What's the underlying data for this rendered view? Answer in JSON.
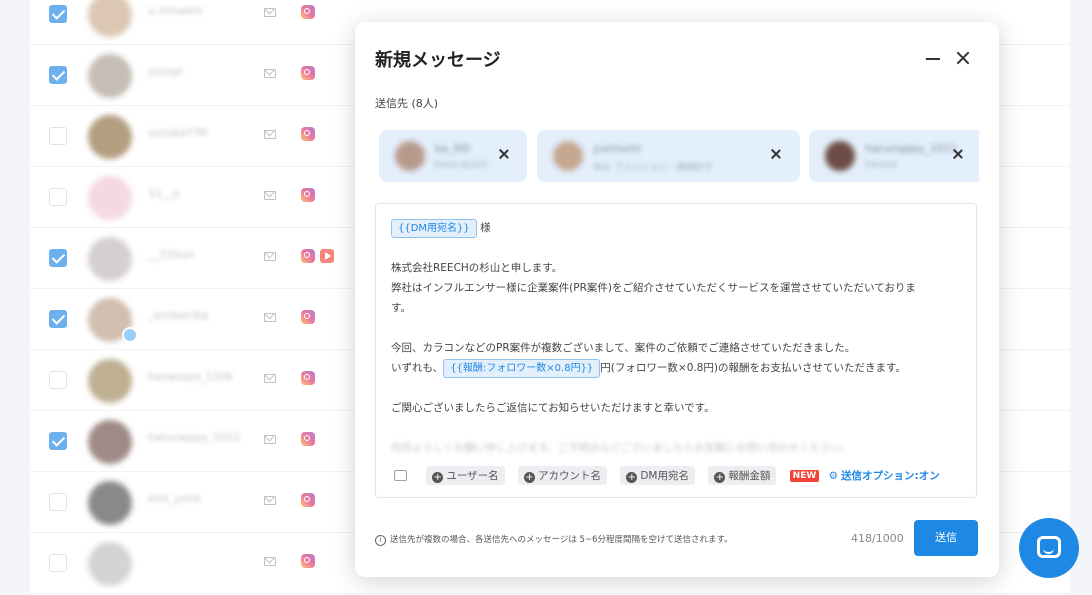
{
  "table": {
    "rows": [
      {
        "checked": true,
        "username": "u.misaato",
        "avatar_color": "#c9a98a",
        "youtube": false,
        "badge": false
      },
      {
        "checked": true,
        "username": "yumpi",
        "avatar_color": "#a89a8c",
        "youtube": false,
        "badge": false
      },
      {
        "checked": false,
        "username": "suzuka738",
        "avatar_color": "#8c6a3c",
        "youtube": false,
        "badge": false
      },
      {
        "checked": false,
        "username": "11__o",
        "avatar_color": "#f0c4d2",
        "youtube": false,
        "badge": false
      },
      {
        "checked": true,
        "username": "__31bun",
        "avatar_color": "#c0b6b8",
        "youtube": true,
        "badge": false
      },
      {
        "checked": true,
        "username": "_emiberika",
        "avatar_color": "#b89c84",
        "youtube": false,
        "badge": true
      },
      {
        "checked": false,
        "username": "kanasaya_110k",
        "avatar_color": "#9c8656",
        "youtube": false,
        "badge": false
      },
      {
        "checked": true,
        "username": "harunappy_1011",
        "avatar_color": "#6c4c44",
        "youtube": false,
        "badge": false
      },
      {
        "checked": false,
        "username": "emi_yone",
        "avatar_color": "#4c4a48",
        "youtube": false,
        "badge": false
      },
      {
        "checked": false,
        "username": "",
        "avatar_color": "#bdbdbd",
        "youtube": false,
        "badge": false
      }
    ]
  },
  "modal": {
    "title": "新規メッセージ",
    "recipients_label": "送信先 (8人)",
    "chips": [
      {
        "name": "ka_00l",
        "sub": "kana ayumi"
      },
      {
        "name": "yumiumi",
        "sub": "ゆみ ファッション・美容好き"
      },
      {
        "name": "harunappy_1011",
        "sub": "haruna"
      }
    ],
    "editor": {
      "name_tag": "{{DM用宛名}}",
      "honorific": "様",
      "line1": "株式会社REECHの杉山と申します。",
      "line2": "弊社はインフルエンサー様に企業案件(PR案件)をご紹介させていただくサービスを運営させていただいておりま",
      "line2b": "す。",
      "line3": "今回、カラコンなどのPR案件が複数ございまして、案件のご依頼でご連絡させていただきました。",
      "line4_pre": "いずれも、",
      "reward_tag": "{{報酬:フォロワー数×0.8円}}",
      "line4_post": "円(フォロワー数×0.8円)の報酬をお支払いさせていただきます。",
      "line5": "ご関心ございましたらご返信にてお知らせいただけますと幸いです。",
      "line6_faded": "何卒よろしくお願い申し上げます。ご不明点などございましたらお気軽にお問い合わせください。"
    },
    "toolbar": {
      "btn_username": "ユーザー名",
      "btn_account": "アカウント名",
      "btn_dm_name": "DM用宛名",
      "btn_reward": "報酬金額",
      "new_badge": "NEW",
      "send_option": "送信オプション:オン"
    },
    "footer_note": "送信先が複数の場合、各送信先へのメッセージは 5~6分程度間隔を空けて送信されます。",
    "char_count": "418/1000",
    "send_label": "送信"
  },
  "colors": {
    "accent": "#1e88e5",
    "chip_bg": "#e3effb",
    "new_badge": "#f44336"
  }
}
